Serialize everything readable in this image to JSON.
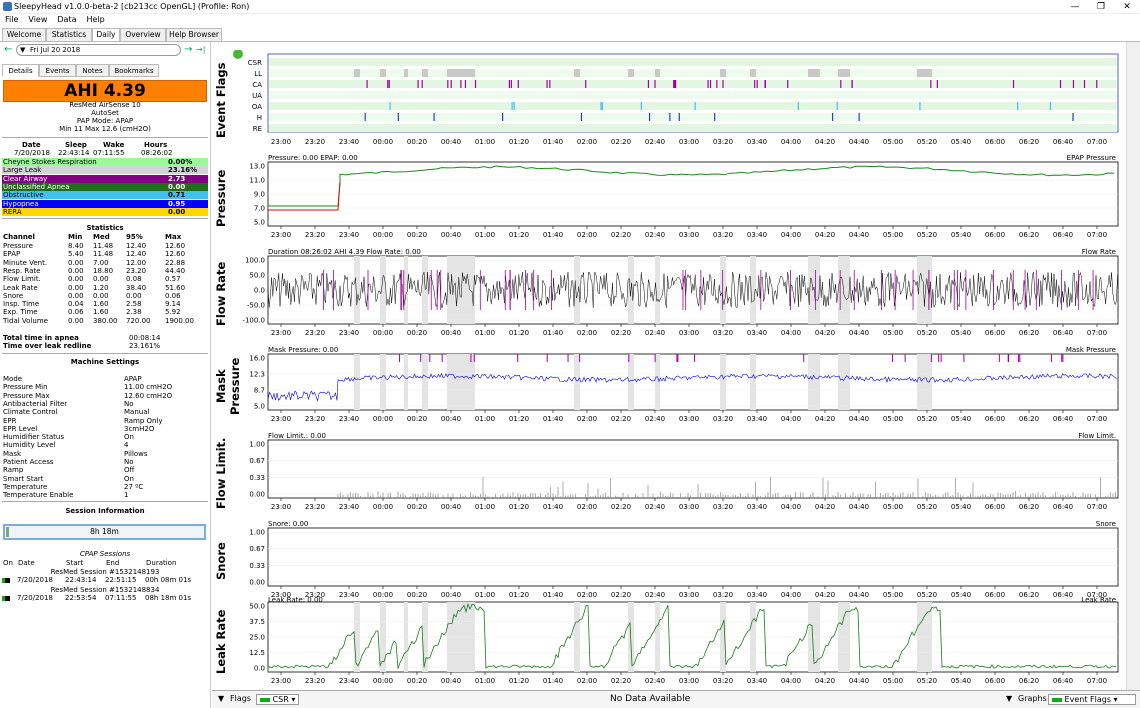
{
  "window": {
    "title": "SleepyHead v1.0.0-beta-2 [cb213cc OpenGL] (Profile: Ron)",
    "min": "—",
    "max": "❐",
    "close": "✕"
  },
  "menu": [
    "File",
    "View",
    "Data",
    "Help"
  ],
  "tabs": [
    "Welcome",
    "Statistics",
    "Daily",
    "Overview",
    "Help Browser"
  ],
  "date": {
    "value": "Fri Jul 20 2018",
    "prev": "←",
    "next": "→",
    "last": "→|"
  },
  "subtabs": [
    "Details",
    "Events",
    "Notes",
    "Bookmarks"
  ],
  "ahi": "AHI 4.39",
  "machine": {
    "model": "ResMed AirSense 10",
    "name": "AutoSet",
    "mode": "PAP Mode: APAP",
    "range": "Min 11 Max 12.6 (cmH2O)"
  },
  "summary": {
    "headers": [
      "Date",
      "Sleep",
      "Wake",
      "Hours"
    ],
    "values": [
      "7/20/2018",
      "22:43:14",
      "07:11:55",
      "08:26:02"
    ]
  },
  "events": [
    {
      "label": "Cheyne Stokes Respiration",
      "value": "0.00%",
      "color": "#98fb98"
    },
    {
      "label": "Large Leak",
      "value": "23.16%",
      "color": "#d3d3d3"
    },
    {
      "label": "Clear Airway",
      "value": "2.73",
      "color": "#800080"
    },
    {
      "label": "Unclassified Apnea",
      "value": "0.00",
      "color": "#1e6e1e"
    },
    {
      "label": "Obstructive",
      "value": "0.71",
      "color": "#40c0f0"
    },
    {
      "label": "Hypopnea",
      "value": "0.95",
      "color": "#0000ff"
    },
    {
      "label": "RERA",
      "value": "0.00",
      "color": "#ffd700"
    }
  ],
  "statistics": {
    "title": "Statistics",
    "headers": [
      "Channel",
      "Min",
      "Med",
      "95%",
      "Max"
    ],
    "rows": [
      [
        "Pressure",
        "8.40",
        "11.48",
        "12.40",
        "12.60"
      ],
      [
        "EPAP",
        "5.40",
        "11.48",
        "12.40",
        "12.60"
      ],
      [
        "Minute Vent.",
        "0.00",
        "7.00",
        "12.00",
        "22.88"
      ],
      [
        "Resp. Rate",
        "0.00",
        "18.80",
        "23.20",
        "44.40"
      ],
      [
        "Flow Limit.",
        "0.00",
        "0.00",
        "0.08",
        "0.57"
      ],
      [
        "Leak Rate",
        "0.00",
        "1.20",
        "38.40",
        "51.60"
      ],
      [
        "Snore",
        "0.00",
        "0.00",
        "0.00",
        "0.06"
      ],
      [
        "Insp. Time",
        "0.04",
        "1.60",
        "2.58",
        "9.14"
      ],
      [
        "Exp. Time",
        "0.06",
        "1.60",
        "2.38",
        "5.92"
      ],
      [
        "Tidal Volume",
        "0.00",
        "380.00",
        "720.00",
        "1900.00"
      ]
    ],
    "apnea_time_label": "Total time in apnea",
    "apnea_time": "00:08:14",
    "leak_label": "Time over leak redline",
    "leak_value": "23.161%"
  },
  "settings": {
    "title": "Machine Settings",
    "rows": [
      [
        "Mode",
        "APAP"
      ],
      [
        "Pressure Min",
        "11.00 cmH2O"
      ],
      [
        "Pressure Max",
        "12.60 cmH2O"
      ],
      [
        "Antibacterial Filter",
        "No"
      ],
      [
        "Climate Control",
        "Manual"
      ],
      [
        "EPR",
        "Ramp Only"
      ],
      [
        "EPR Level",
        "3cmH2O"
      ],
      [
        "Humidifier Status",
        "On"
      ],
      [
        "Humidity Level",
        "4"
      ],
      [
        "Mask",
        "Pillows"
      ],
      [
        "Patient Access",
        "No"
      ],
      [
        "Ramp",
        "Off"
      ],
      [
        "Smart Start",
        "On"
      ],
      [
        "Temperature",
        "27 ºC"
      ],
      [
        "Temperature Enable",
        "1"
      ]
    ]
  },
  "session": {
    "title": "Session Information",
    "bar": "8h 18m",
    "cpap_title": "CPAP Sessions",
    "headers": [
      "On",
      "Date",
      "Start",
      "End",
      "Duration"
    ],
    "list": [
      {
        "name": "ResMed Session #1532148193",
        "date": "7/20/2018",
        "start": "22:43:14",
        "end": "22:51:15",
        "dur": "00h 08m 01s"
      },
      {
        "name": "ResMed Session #1532148834",
        "date": "7/20/2018",
        "start": "22:53:54",
        "end": "07:11:55",
        "dur": "08h 18m 01s"
      }
    ]
  },
  "graphs": {
    "time_ticks": [
      "23:00",
      "23:20",
      "23:40",
      "00:00",
      "00:20",
      "00:40",
      "01:00",
      "01:20",
      "01:40",
      "02:00",
      "02:20",
      "02:40",
      "03:00",
      "03:20",
      "03:40",
      "04:00",
      "04:20",
      "04:40",
      "05:00",
      "05:20",
      "05:40",
      "06:00",
      "06:20",
      "06:40",
      "07:00"
    ],
    "event_flags": {
      "title": "Event Flags",
      "rows": [
        "CSR",
        "LL",
        "CA",
        "UA",
        "OA",
        "H",
        "RE"
      ]
    },
    "pressure": {
      "title": "Pressure",
      "label": "Pressure: 0.00 EPAP: 0.00",
      "legend": "EPAP Pressure",
      "yticks": [
        "13.0",
        "11.0",
        "9.0",
        "7.0",
        "5.0"
      ]
    },
    "flow": {
      "title": "Flow Rate",
      "label": "Duration 08:26:02 AHI 4.39 Flow Rate: 0.00",
      "legend": "Flow Rate",
      "yticks": [
        "100.0",
        "50.0",
        "0.0",
        "-50.0",
        "-100.0"
      ]
    },
    "mask": {
      "title": "Mask Pressure",
      "label": "Mask Pressure: 0.00",
      "legend": "Mask Pressure",
      "yticks": [
        "16.0",
        "12.3",
        "8.7",
        "5.0"
      ]
    },
    "flowlim": {
      "title": "Flow Limit.",
      "label": "Flow Limit.: 0.00",
      "legend": "Flow Limit.",
      "yticks": [
        "1.00",
        "0.67",
        "0.33",
        "0.00"
      ]
    },
    "snore": {
      "title": "Snore",
      "label": "Snore: 0.00",
      "legend": "Snore",
      "yticks": [
        "1.00",
        "0.67",
        "0.33",
        "0.00"
      ]
    },
    "leak": {
      "title": "Leak Rate",
      "label": "Leak Rate: 0.00",
      "legend": "Leak Rate",
      "yticks": [
        "50.0",
        "37.5",
        "25.0",
        "12.5",
        "0.0"
      ]
    }
  },
  "bottom": {
    "flags": "Flags",
    "csr": "CSR",
    "nodata": "No Data Available",
    "graphs": "Graphs",
    "eventflags": "Event Flags"
  },
  "colors": {
    "ahi": "#ff8000",
    "pressure": "#1a8a1a",
    "flow": "#000000",
    "mask": "#0000e0",
    "leak": "#1a7a1a",
    "flag_band": "#dff5df"
  }
}
